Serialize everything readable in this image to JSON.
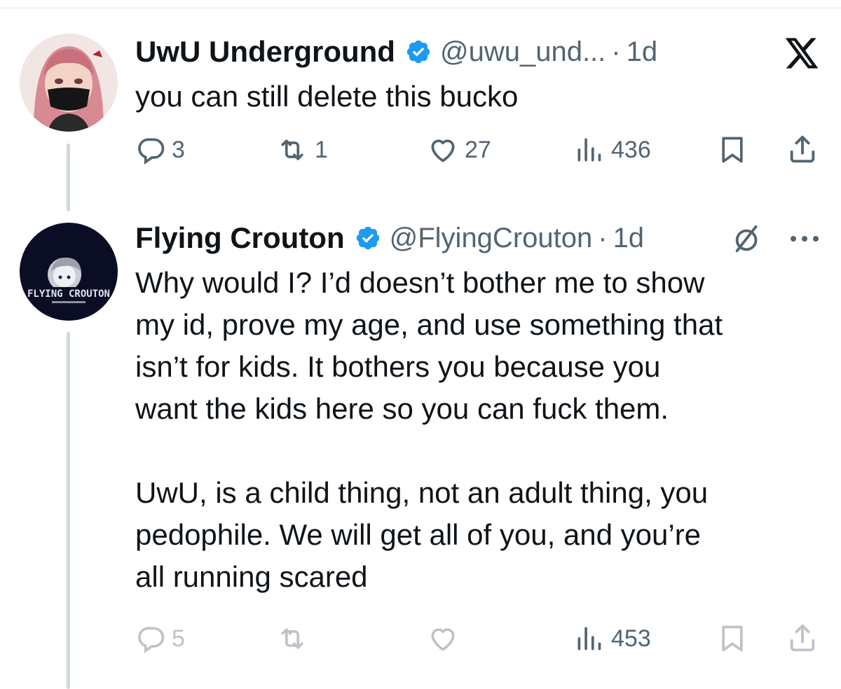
{
  "tweets": [
    {
      "display_name": "UwU Underground",
      "handle": "@uwu_und...",
      "separator": "·",
      "time": "1d",
      "text": "you can still delete this bucko",
      "actions": {
        "replies": "3",
        "reposts": "1",
        "likes": "27",
        "views": "436"
      },
      "corner_icon": "x-logo-icon"
    },
    {
      "display_name": "Flying Crouton",
      "handle": "@FlyingCrouton",
      "separator": "·",
      "time": "1d",
      "text": "Why would I? I’d doesn’t bother me to show\nmy id, prove my age, and use something that\nisn’t for kids. It bothers you because you\nwant the kids here so you can fuck them.\n\nUwU, is a child thing, not an adult thing, you\npedophile. We will get all of you, and you’re\nall running scared",
      "avatar_text": "FLYING CROUTON",
      "actions": {
        "replies": "5",
        "reposts": "",
        "likes": "",
        "views": "453"
      },
      "corner_icons": [
        "grok-slash-icon",
        "more-icon"
      ]
    }
  ],
  "colors": {
    "verified": "#1d9bf0",
    "text": "#0f1419",
    "secondary": "#536471",
    "thread_line": "#cfd9de"
  }
}
